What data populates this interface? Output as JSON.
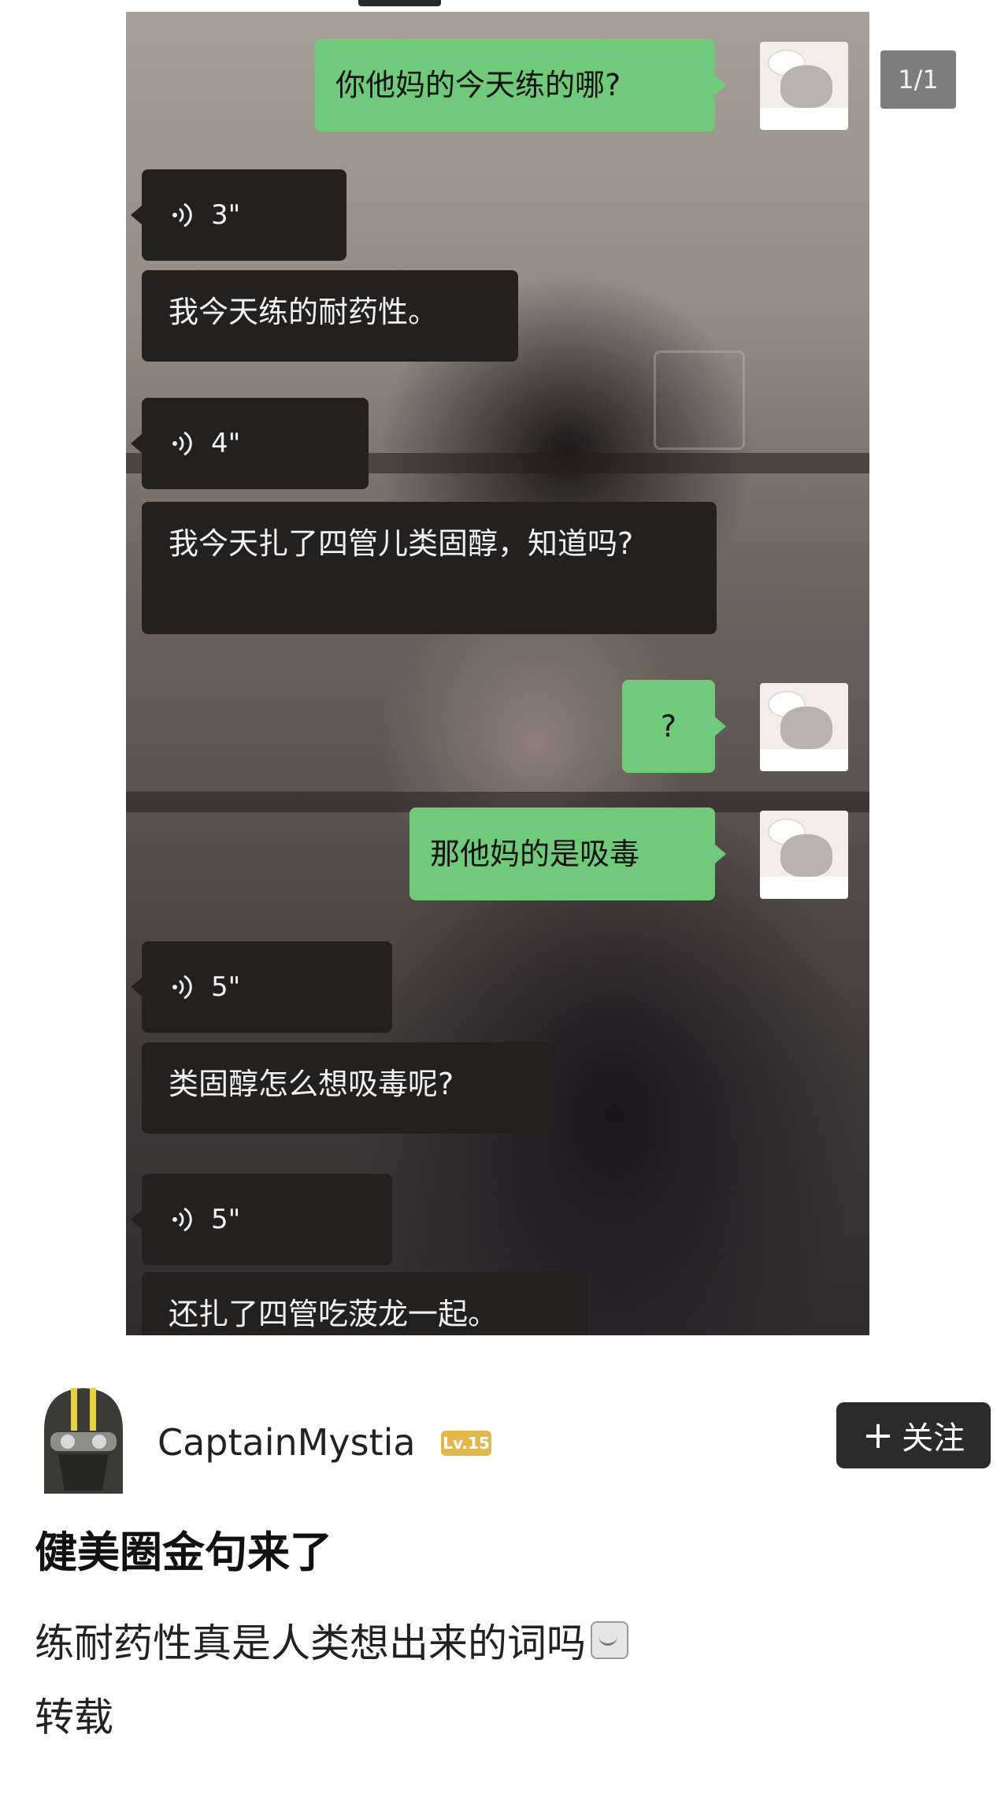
{
  "page_counter": "1/1",
  "chat": {
    "messages": [
      {
        "type": "sent",
        "text": "你他妈的今天练的哪?"
      },
      {
        "type": "voice",
        "duration": "3\""
      },
      {
        "type": "received",
        "text": "我今天练的耐药性。"
      },
      {
        "type": "voice",
        "duration": "4\""
      },
      {
        "type": "received",
        "text": "我今天扎了四管儿类固醇，知道吗?"
      },
      {
        "type": "sent",
        "text": "?"
      },
      {
        "type": "sent",
        "text": "那他妈的是吸毒"
      },
      {
        "type": "voice",
        "duration": "5\""
      },
      {
        "type": "received",
        "text": "类固醇怎么想吸毒呢?"
      },
      {
        "type": "voice",
        "duration": "5\""
      },
      {
        "type": "received",
        "text": "还扎了四管吃菠龙一起。"
      }
    ]
  },
  "author": {
    "username": "CaptainMystia",
    "level": "Lv.15",
    "follow_label": "关注",
    "follow_icon": "+"
  },
  "post": {
    "title": "健美圈金句来了",
    "text": "练耐药性真是人类想出来的词吗",
    "emoji_icon": "smile-face-emoji",
    "repost_label": "转载"
  },
  "colors": {
    "sent_bubble": "#6fcb79",
    "received_bubble": "#232020",
    "level_badge": "#e2b84a",
    "follow_button": "#2b2b2b"
  }
}
